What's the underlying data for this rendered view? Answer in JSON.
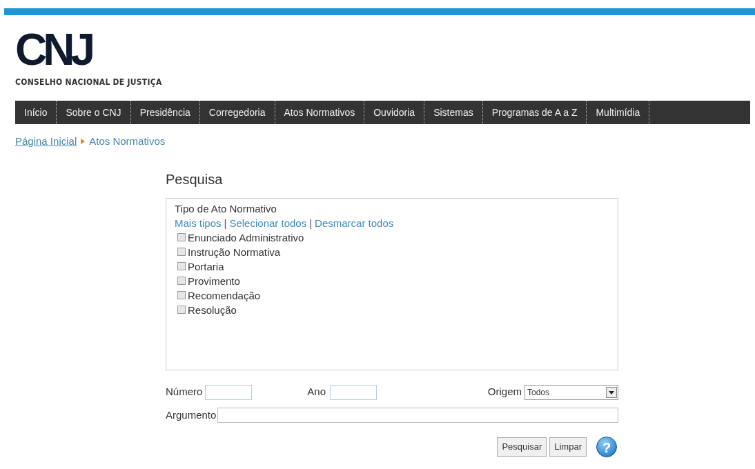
{
  "logo": {
    "mark": "CNJ",
    "name": "CONSELHO NACIONAL DE JUSTIÇA"
  },
  "nav": [
    {
      "label": "Início"
    },
    {
      "label": "Sobre o CNJ"
    },
    {
      "label": "Presidência"
    },
    {
      "label": "Corregedoria"
    },
    {
      "label": "Atos Normativos"
    },
    {
      "label": "Ouvidoria"
    },
    {
      "label": "Sistemas"
    },
    {
      "label": "Programas de A a Z"
    },
    {
      "label": "Multimídia"
    }
  ],
  "breadcrumb": [
    "Página Inicial",
    "Atos Normativos"
  ],
  "search": {
    "title": "Pesquisa",
    "types": {
      "title": "Tipo de Ato Normativo",
      "links": [
        "Mais tipos",
        "Selecionar todos",
        "Desmarcar todos"
      ],
      "separator": "|",
      "options": [
        {
          "label": "Enunciado Administrativo",
          "checked": false
        },
        {
          "label": "Instrução Normativa",
          "checked": false
        },
        {
          "label": "Portaria",
          "checked": false
        },
        {
          "label": "Provimento",
          "checked": false
        },
        {
          "label": "Recomendação",
          "checked": false
        },
        {
          "label": "Resolução",
          "checked": false
        }
      ]
    },
    "numero_label": "Número",
    "ano_label": "Ano",
    "origem_label": "Origem",
    "origem_value": "Todos",
    "argumento_label": "Argumento",
    "buttons": [
      "Pesquisar",
      "Limpar"
    ],
    "help": "?"
  }
}
